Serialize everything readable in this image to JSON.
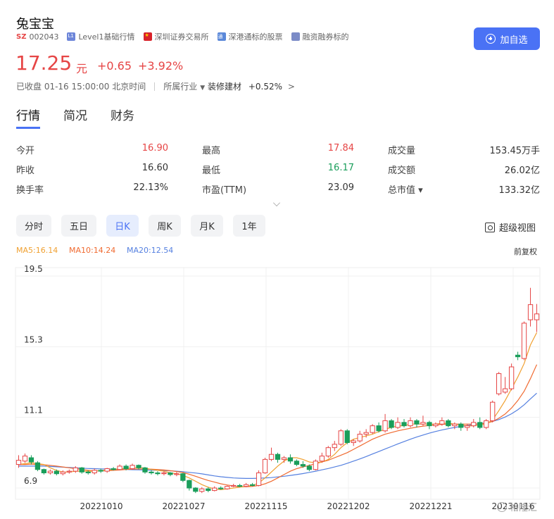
{
  "stock": {
    "name": "兔宝宝",
    "market": "SZ",
    "code": "002043",
    "tags": [
      {
        "icon": "level1-icon",
        "label": "Level1基础行情"
      },
      {
        "icon": "china-flag-icon",
        "label": "深圳证券交易所"
      },
      {
        "icon": "stock-connect-icon",
        "label": "深港通标的股票"
      },
      {
        "icon": "margin-icon",
        "label": "融资融券标的"
      }
    ],
    "add_label": "加自选",
    "price": "17.25",
    "unit": "元",
    "change": "+0.65",
    "change_pct": "+3.92%",
    "status": "已收盘 01-16 15:00:00 北京时间",
    "industry_label": "所属行业",
    "industry": "装修建材",
    "industry_change": "+0.52%"
  },
  "tabs": [
    "行情",
    "简况",
    "财务"
  ],
  "stats": [
    [
      {
        "label": "今开",
        "value": "16.90",
        "color": "red"
      },
      {
        "label": "最高",
        "value": "17.84",
        "color": "red"
      },
      {
        "label": "成交量",
        "value": "153.45万手",
        "color": ""
      }
    ],
    [
      {
        "label": "昨收",
        "value": "16.60",
        "color": ""
      },
      {
        "label": "最低",
        "value": "16.17",
        "color": "green"
      },
      {
        "label": "成交额",
        "value": "26.02亿",
        "color": ""
      }
    ],
    [
      {
        "label": "换手率",
        "value": "22.13%",
        "color": ""
      },
      {
        "label": "市盈(TTM)",
        "value": "23.09",
        "color": ""
      },
      {
        "label": "总市值 ▾",
        "value": "133.32亿",
        "color": ""
      }
    ]
  ],
  "periods": [
    "分时",
    "五日",
    "日K",
    "周K",
    "月K",
    "1年"
  ],
  "active_period": "日K",
  "super_view": "超级视图",
  "ma": {
    "ma5": "MA5:16.14",
    "ma10": "MA10:14.24",
    "ma20": "MA20:12.54"
  },
  "adjust": "前复权",
  "watermark": "格隆汇",
  "colors": {
    "up": "#e64545",
    "down": "#1a9e5b",
    "ma5": "#f0a030",
    "ma10": "#f06a30",
    "ma20": "#5580e0",
    "accent": "#4a72f5"
  },
  "chart_data": {
    "type": "candlestick",
    "y_ticks": [
      "19.5",
      "15.3",
      "11.1",
      "6.9"
    ],
    "ylim": [
      6.9,
      19.5
    ],
    "x_ticks": [
      "20221010",
      "20221027",
      "20221115",
      "20221202",
      "20221221",
      "20230116"
    ],
    "candles": [
      {
        "o": 8.3,
        "c": 8.55,
        "h": 8.85,
        "l": 8.1
      },
      {
        "o": 8.5,
        "c": 8.8,
        "h": 8.95,
        "l": 8.4
      },
      {
        "o": 8.7,
        "c": 8.45,
        "h": 8.85,
        "l": 8.3
      },
      {
        "o": 8.4,
        "c": 8.0,
        "h": 8.5,
        "l": 7.9
      },
      {
        "o": 8.0,
        "c": 7.8,
        "h": 8.05,
        "l": 7.7
      },
      {
        "o": 7.8,
        "c": 7.9,
        "h": 8.0,
        "l": 7.7
      },
      {
        "o": 7.9,
        "c": 7.75,
        "h": 8.0,
        "l": 7.65
      },
      {
        "o": 7.75,
        "c": 7.85,
        "h": 7.95,
        "l": 7.65
      },
      {
        "o": 7.85,
        "c": 7.9,
        "h": 8.0,
        "l": 7.75
      },
      {
        "o": 7.9,
        "c": 8.1,
        "h": 8.2,
        "l": 7.8
      },
      {
        "o": 8.1,
        "c": 7.85,
        "h": 8.15,
        "l": 7.75
      },
      {
        "o": 7.85,
        "c": 7.8,
        "h": 7.95,
        "l": 7.7
      },
      {
        "o": 7.8,
        "c": 7.95,
        "h": 8.05,
        "l": 7.7
      },
      {
        "o": 7.95,
        "c": 7.9,
        "h": 8.05,
        "l": 7.8
      },
      {
        "o": 7.9,
        "c": 8.05,
        "h": 8.1,
        "l": 7.8
      },
      {
        "o": 8.05,
        "c": 8.0,
        "h": 8.15,
        "l": 7.95
      },
      {
        "o": 8.0,
        "c": 8.2,
        "h": 8.3,
        "l": 7.95
      },
      {
        "o": 8.2,
        "c": 8.05,
        "h": 8.3,
        "l": 7.95
      },
      {
        "o": 8.05,
        "c": 8.25,
        "h": 8.35,
        "l": 8.0
      },
      {
        "o": 8.25,
        "c": 8.1,
        "h": 8.3,
        "l": 8.0
      },
      {
        "o": 8.1,
        "c": 7.85,
        "h": 8.15,
        "l": 7.75
      },
      {
        "o": 7.85,
        "c": 7.8,
        "h": 7.95,
        "l": 7.7
      },
      {
        "o": 7.8,
        "c": 7.75,
        "h": 7.9,
        "l": 7.65
      },
      {
        "o": 7.75,
        "c": 7.8,
        "h": 7.9,
        "l": 7.65
      },
      {
        "o": 7.8,
        "c": 7.7,
        "h": 7.85,
        "l": 7.6
      },
      {
        "o": 7.7,
        "c": 7.75,
        "h": 7.85,
        "l": 7.6
      },
      {
        "o": 7.75,
        "c": 7.35,
        "h": 7.8,
        "l": 7.25
      },
      {
        "o": 7.35,
        "c": 6.9,
        "h": 7.4,
        "l": 6.75
      },
      {
        "o": 6.9,
        "c": 6.7,
        "h": 6.95,
        "l": 6.6
      },
      {
        "o": 6.7,
        "c": 6.85,
        "h": 6.95,
        "l": 6.6
      },
      {
        "o": 6.85,
        "c": 6.75,
        "h": 6.95,
        "l": 6.65
      },
      {
        "o": 6.75,
        "c": 6.9,
        "h": 7.0,
        "l": 6.7
      },
      {
        "o": 6.9,
        "c": 6.85,
        "h": 7.0,
        "l": 6.8
      },
      {
        "o": 6.85,
        "c": 7.0,
        "h": 7.05,
        "l": 6.8
      },
      {
        "o": 7.0,
        "c": 7.05,
        "h": 7.15,
        "l": 6.95
      },
      {
        "o": 7.05,
        "c": 7.0,
        "h": 7.15,
        "l": 6.95
      },
      {
        "o": 7.0,
        "c": 7.1,
        "h": 7.2,
        "l": 6.95
      },
      {
        "o": 7.1,
        "c": 7.05,
        "h": 7.2,
        "l": 7.0
      },
      {
        "o": 7.05,
        "c": 7.8,
        "h": 7.95,
        "l": 7.0
      },
      {
        "o": 7.8,
        "c": 8.6,
        "h": 8.7,
        "l": 7.75
      },
      {
        "o": 8.6,
        "c": 8.9,
        "h": 9.3,
        "l": 8.5
      },
      {
        "o": 8.9,
        "c": 8.6,
        "h": 9.0,
        "l": 8.4
      },
      {
        "o": 8.6,
        "c": 8.7,
        "h": 8.8,
        "l": 8.4
      },
      {
        "o": 8.7,
        "c": 8.5,
        "h": 8.9,
        "l": 8.35
      },
      {
        "o": 8.5,
        "c": 8.3,
        "h": 8.6,
        "l": 8.2
      },
      {
        "o": 8.3,
        "c": 8.2,
        "h": 8.5,
        "l": 8.1
      },
      {
        "o": 8.2,
        "c": 8.0,
        "h": 8.3,
        "l": 7.9
      },
      {
        "o": 8.0,
        "c": 8.5,
        "h": 8.6,
        "l": 7.95
      },
      {
        "o": 8.5,
        "c": 8.8,
        "h": 9.0,
        "l": 8.4
      },
      {
        "o": 8.8,
        "c": 9.3,
        "h": 9.4,
        "l": 8.7
      },
      {
        "o": 9.3,
        "c": 9.5,
        "h": 9.7,
        "l": 9.1
      },
      {
        "o": 9.5,
        "c": 10.3,
        "h": 10.4,
        "l": 9.4
      },
      {
        "o": 10.3,
        "c": 9.6,
        "h": 10.4,
        "l": 9.5
      },
      {
        "o": 9.6,
        "c": 9.7,
        "h": 9.8,
        "l": 9.4
      },
      {
        "o": 9.7,
        "c": 10.1,
        "h": 10.3,
        "l": 9.6
      },
      {
        "o": 10.1,
        "c": 10.2,
        "h": 10.4,
        "l": 9.9
      },
      {
        "o": 10.2,
        "c": 10.6,
        "h": 10.7,
        "l": 10.1
      },
      {
        "o": 10.6,
        "c": 10.3,
        "h": 10.8,
        "l": 10.2
      },
      {
        "o": 10.3,
        "c": 10.9,
        "h": 11.3,
        "l": 10.2
      },
      {
        "o": 10.9,
        "c": 10.5,
        "h": 11.0,
        "l": 10.4
      },
      {
        "o": 10.5,
        "c": 10.8,
        "h": 11.1,
        "l": 10.4
      },
      {
        "o": 10.8,
        "c": 10.6,
        "h": 11.0,
        "l": 10.5
      },
      {
        "o": 10.6,
        "c": 10.9,
        "h": 11.1,
        "l": 10.5
      },
      {
        "o": 10.9,
        "c": 10.7,
        "h": 11.0,
        "l": 10.5
      },
      {
        "o": 10.7,
        "c": 10.8,
        "h": 11.2,
        "l": 10.6
      },
      {
        "o": 10.8,
        "c": 10.6,
        "h": 10.9,
        "l": 10.4
      },
      {
        "o": 10.6,
        "c": 10.7,
        "h": 10.8,
        "l": 10.5
      },
      {
        "o": 10.7,
        "c": 10.9,
        "h": 11.1,
        "l": 10.6
      },
      {
        "o": 10.9,
        "c": 10.6,
        "h": 11.0,
        "l": 10.5
      },
      {
        "o": 10.6,
        "c": 10.7,
        "h": 10.8,
        "l": 10.4
      },
      {
        "o": 10.7,
        "c": 10.5,
        "h": 10.8,
        "l": 10.3
      },
      {
        "o": 10.5,
        "c": 10.6,
        "h": 10.7,
        "l": 10.3
      },
      {
        "o": 10.6,
        "c": 10.8,
        "h": 11.0,
        "l": 10.5
      },
      {
        "o": 10.8,
        "c": 10.5,
        "h": 11.1,
        "l": 10.4
      },
      {
        "o": 10.5,
        "c": 10.9,
        "h": 11.0,
        "l": 10.4
      },
      {
        "o": 10.9,
        "c": 12.0,
        "h": 12.1,
        "l": 10.8
      },
      {
        "o": 12.5,
        "c": 13.7,
        "h": 13.8,
        "l": 12.4
      },
      {
        "o": 12.6,
        "c": 12.8,
        "h": 13.5,
        "l": 12.5
      },
      {
        "o": 12.8,
        "c": 14.1,
        "h": 14.3,
        "l": 12.7
      },
      {
        "o": 14.8,
        "c": 14.7,
        "h": 15.0,
        "l": 14.5
      },
      {
        "o": 14.6,
        "c": 16.7,
        "h": 16.8,
        "l": 14.5
      },
      {
        "o": 16.9,
        "c": 17.8,
        "h": 18.8,
        "l": 16.5
      },
      {
        "o": 16.9,
        "c": 17.25,
        "h": 17.84,
        "l": 16.17
      }
    ],
    "ma5": [
      8.3,
      8.35,
      8.4,
      8.35,
      8.3,
      8.1,
      7.95,
      7.85,
      7.85,
      7.9,
      7.9,
      7.9,
      7.9,
      7.95,
      7.95,
      8.0,
      8.05,
      8.05,
      8.1,
      8.1,
      8.1,
      8.0,
      7.95,
      7.9,
      7.8,
      7.75,
      7.65,
      7.5,
      7.3,
      7.1,
      6.95,
      6.85,
      6.8,
      6.85,
      6.9,
      6.95,
      7.0,
      7.05,
      7.2,
      7.5,
      7.85,
      8.2,
      8.5,
      8.7,
      8.7,
      8.6,
      8.45,
      8.4,
      8.45,
      8.6,
      8.9,
      9.3,
      9.6,
      9.8,
      9.9,
      10.0,
      10.1,
      10.25,
      10.4,
      10.5,
      10.6,
      10.6,
      10.7,
      10.7,
      10.7,
      10.7,
      10.7,
      10.75,
      10.75,
      10.7,
      10.65,
      10.6,
      10.6,
      10.65,
      10.7,
      10.95,
      11.5,
      12.1,
      12.8,
      13.5,
      14.3,
      15.4,
      16.14
    ],
    "ma10": [
      8.3,
      8.3,
      8.32,
      8.3,
      8.28,
      8.25,
      8.2,
      8.15,
      8.1,
      8.05,
      8.0,
      7.95,
      7.92,
      7.92,
      7.93,
      7.95,
      7.97,
      8.0,
      8.02,
      8.03,
      8.03,
      8.02,
      8.0,
      7.97,
      7.93,
      7.88,
      7.82,
      7.72,
      7.6,
      7.47,
      7.35,
      7.25,
      7.15,
      7.08,
      7.02,
      6.98,
      6.98,
      7.0,
      7.05,
      7.15,
      7.3,
      7.5,
      7.7,
      7.9,
      8.05,
      8.15,
      8.25,
      8.35,
      8.45,
      8.55,
      8.7,
      8.85,
      9.0,
      9.2,
      9.4,
      9.6,
      9.8,
      9.95,
      10.1,
      10.2,
      10.3,
      10.38,
      10.45,
      10.52,
      10.58,
      10.62,
      10.65,
      10.68,
      10.7,
      10.7,
      10.7,
      10.7,
      10.7,
      10.72,
      10.75,
      10.85,
      11.05,
      11.3,
      11.65,
      12.1,
      12.65,
      13.4,
      14.24
    ],
    "ma20": [
      8.2,
      8.2,
      8.2,
      8.2,
      8.2,
      8.18,
      8.16,
      8.14,
      8.12,
      8.1,
      8.08,
      8.06,
      8.05,
      8.04,
      8.03,
      8.02,
      8.01,
      8.0,
      7.99,
      7.98,
      7.97,
      7.96,
      7.95,
      7.94,
      7.92,
      7.9,
      7.87,
      7.83,
      7.79,
      7.74,
      7.68,
      7.62,
      7.57,
      7.53,
      7.5,
      7.48,
      7.47,
      7.47,
      7.48,
      7.5,
      7.52,
      7.56,
      7.6,
      7.65,
      7.7,
      7.76,
      7.83,
      7.9,
      7.98,
      8.06,
      8.15,
      8.25,
      8.37,
      8.5,
      8.63,
      8.77,
      8.92,
      9.07,
      9.22,
      9.37,
      9.52,
      9.66,
      9.8,
      9.93,
      10.05,
      10.16,
      10.26,
      10.35,
      10.43,
      10.5,
      10.56,
      10.62,
      10.67,
      10.72,
      10.78,
      10.86,
      10.97,
      11.12,
      11.31,
      11.55,
      11.85,
      12.2,
      12.54
    ]
  }
}
